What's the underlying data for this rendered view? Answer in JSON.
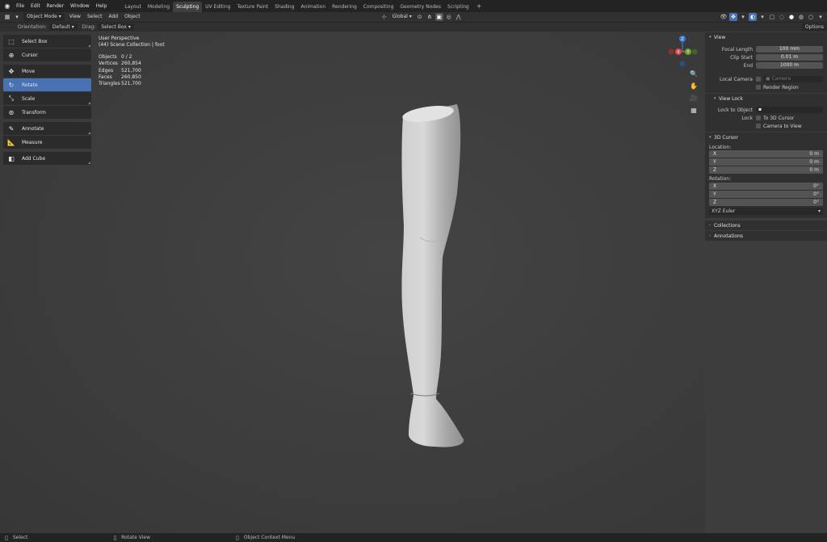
{
  "topbar": {
    "menus": [
      "File",
      "Edit",
      "Render",
      "Window",
      "Help"
    ],
    "workspaces": [
      "Layout",
      "Modeling",
      "Sculpting",
      "UV Editing",
      "Texture Paint",
      "Shading",
      "Animation",
      "Rendering",
      "Compositing",
      "Geometry Nodes",
      "Scripting"
    ],
    "active_workspace": "Sculpting",
    "add_tab": "+"
  },
  "header": {
    "mode": "Object Mode",
    "menus": [
      "View",
      "Select",
      "Add",
      "Object"
    ],
    "transform_orientation": "Global"
  },
  "tool_settings": {
    "orientation_label": "Orientation:",
    "orientation_value": "Default",
    "drag_label": "Drag:",
    "drag_value": "Select Box",
    "options_label": "Options"
  },
  "toolbar": {
    "tools": [
      {
        "label": "Select Box",
        "icon": "select-box-icon"
      },
      {
        "label": "Cursor",
        "icon": "cursor-icon"
      },
      {
        "label": "Move",
        "icon": "move-icon"
      },
      {
        "label": "Rotate",
        "icon": "rotate-icon"
      },
      {
        "label": "Scale",
        "icon": "scale-icon"
      },
      {
        "label": "Transform",
        "icon": "transform-icon"
      },
      {
        "label": "Annotate",
        "icon": "annotate-icon"
      },
      {
        "label": "Measure",
        "icon": "measure-icon"
      },
      {
        "label": "Add Cube",
        "icon": "add-cube-icon"
      }
    ],
    "active_tool": "Rotate"
  },
  "overlay": {
    "view_name": "User Perspective",
    "collection": "(44) Scene Collection | foot",
    "stats": [
      {
        "k": "Objects",
        "v": "0 / 2"
      },
      {
        "k": "Vertices",
        "v": "260,854"
      },
      {
        "k": "Edges",
        "v": "521,700"
      },
      {
        "k": "Faces",
        "v": "260,850"
      },
      {
        "k": "Triangles",
        "v": "521,700"
      }
    ]
  },
  "gizmo": {
    "z": "Z",
    "y": "Y",
    "x": "X",
    "colors": {
      "x": "#e0464e",
      "y": "#6fa331",
      "z": "#3a7ad6"
    }
  },
  "sidebar": {
    "view_title": "View",
    "focal_length_label": "Focal Length",
    "focal_length": "100 mm",
    "clip_start_label": "Clip Start",
    "clip_start": "0.01 m",
    "end_label": "End",
    "end": "1000 m",
    "local_camera_label": "Local Camera",
    "local_camera_placeholder": "Camera",
    "render_region": "Render Region",
    "view_lock_title": "View Lock",
    "lock_to_object_label": "Lock to Object",
    "lock_label": "Lock",
    "to_3d_cursor": "To 3D Cursor",
    "camera_to_view": "Camera to View",
    "cursor_title": "3D Cursor",
    "location_label": "Location:",
    "location": [
      {
        "axis": "X",
        "v": "0 m"
      },
      {
        "axis": "Y",
        "v": "0 m"
      },
      {
        "axis": "Z",
        "v": "0 m"
      }
    ],
    "rotation_label": "Rotation:",
    "rotation": [
      {
        "axis": "X",
        "v": "0°"
      },
      {
        "axis": "Y",
        "v": "0°"
      },
      {
        "axis": "Z",
        "v": "0°"
      }
    ],
    "rotation_mode": "XYZ Euler",
    "collections_title": "Collections",
    "annotations_title": "Annotations"
  },
  "statusbar": {
    "items": [
      {
        "icon": "mouse-left-icon",
        "label": "Select"
      },
      {
        "icon": "mouse-middle-icon",
        "label": "Rotate View"
      },
      {
        "icon": "mouse-right-icon",
        "label": "Object Context Menu"
      }
    ]
  },
  "colors": {
    "accent": "#4772b3",
    "background": "#3d3d3d",
    "panel": "#303030",
    "topbar": "#232323"
  }
}
